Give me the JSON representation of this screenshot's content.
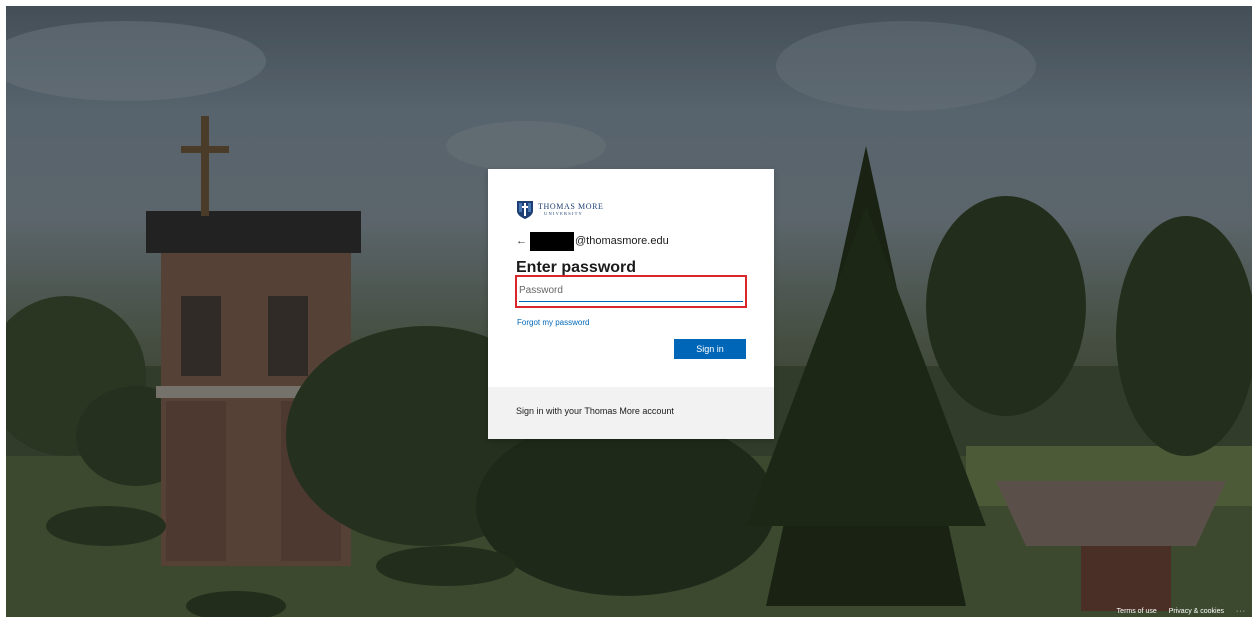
{
  "org": {
    "logo_line1": "THOMAS MORE",
    "logo_line2": "UNIVERSITY",
    "brand_color": "#1d3f73"
  },
  "identity": {
    "back_symbol": "←",
    "email_domain": "@thomasmore.edu"
  },
  "form": {
    "title": "Enter password",
    "password_placeholder": "Password",
    "forgot_label": "Forgot my password",
    "signin_label": "Sign in",
    "accent_color": "#0067b8",
    "highlight_color": "#d9262c"
  },
  "footer": {
    "card_text": "Sign in with your Thomas More account",
    "terms_label": "Terms of use",
    "privacy_label": "Privacy & cookies",
    "more_label": "···"
  }
}
